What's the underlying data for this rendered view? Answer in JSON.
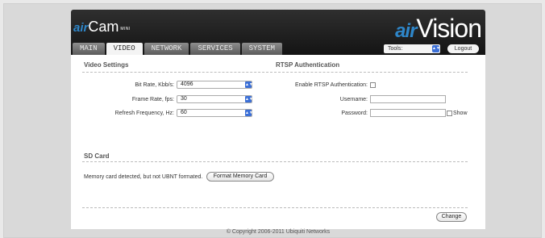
{
  "brand": {
    "left_prefix": "air",
    "left_name": "Cam",
    "left_suffix": "MINI",
    "right_prefix": "air",
    "right_name": "Vision"
  },
  "tabs": [
    {
      "label": "MAIN"
    },
    {
      "label": "VIDEO"
    },
    {
      "label": "NETWORK"
    },
    {
      "label": "SERVICES"
    },
    {
      "label": "SYSTEM"
    }
  ],
  "header": {
    "tools_label": "Tools:",
    "logout_label": "Logout"
  },
  "video_settings": {
    "title": "Video Settings",
    "bit_rate_label": "Bit Rate, Kbb/s:",
    "bit_rate_value": "4096",
    "frame_rate_label": "Frame Rate, fps:",
    "frame_rate_value": "30",
    "refresh_label": "Refresh Frequency, Hz:",
    "refresh_value": "60"
  },
  "rtsp": {
    "title": "RTSP Authentication",
    "enable_label": "Enable RTSP Authentication:",
    "username_label": "Username:",
    "password_label": "Password:",
    "show_label": "Show"
  },
  "sd_card": {
    "title": "SD Card",
    "status": "Memory card detected, but not UBNT formated.",
    "format_button": "Format Memory Card"
  },
  "change_button": "Change",
  "footer": "© Copyright 2006-2011 Ubiquiti Networks",
  "colors": {
    "brand_blue": "#2e86c9",
    "header_dark": "#1e1e1e",
    "select_arrow": "#3b6fd6"
  }
}
